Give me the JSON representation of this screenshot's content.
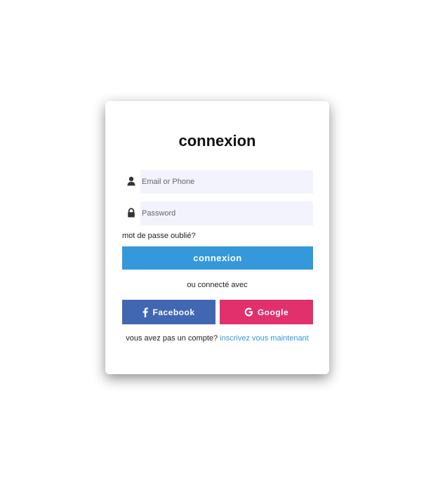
{
  "login": {
    "title": "connexion",
    "email_placeholder": "Email or Phone",
    "password_placeholder": "Password",
    "forgot_password": "mot de passe oublié?",
    "submit_label": "connexion",
    "or_text": "ou connecté avec",
    "facebook_label": "Facebook",
    "google_label": "Google",
    "signup_text": "vous avez pas un compte?",
    "signup_link": "inscrivez vous maintenant"
  },
  "icons": {
    "email": "user-icon",
    "password": "lock-icon",
    "facebook": "facebook-icon",
    "google": "google-icon"
  },
  "colors": {
    "primary": "#3498db",
    "facebook": "#4267b2",
    "google": "#e1306c",
    "input_bg": "#f3f3fd"
  }
}
